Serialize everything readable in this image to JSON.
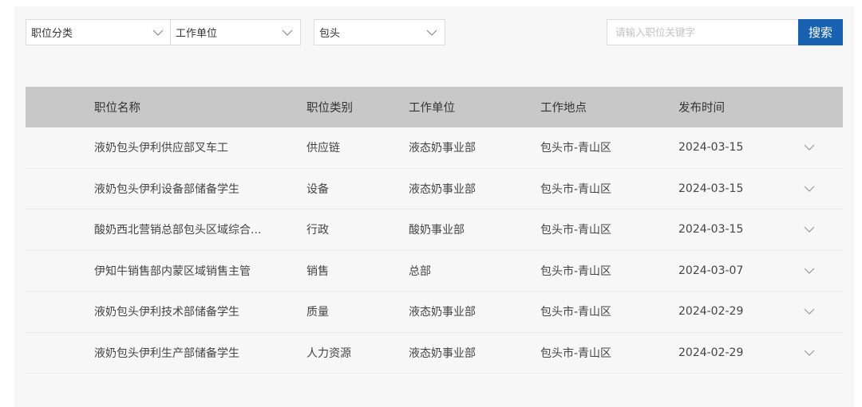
{
  "filters": {
    "category": {
      "value": "职位分类"
    },
    "unit": {
      "value": "工作单位"
    },
    "location": {
      "value": "包头"
    }
  },
  "search": {
    "placeholder": "请输入职位关键字",
    "value": "",
    "button_label": "搜索",
    "button_color": "#1860b0"
  },
  "table": {
    "headers": [
      "职位名称",
      "职位类别",
      "工作单位",
      "工作地点",
      "发布时间"
    ],
    "rows": [
      {
        "title": "液奶包头伊利供应部叉车工",
        "category": "供应链",
        "unit": "液态奶事业部",
        "location": "包头市-青山区",
        "date": "2024-03-15"
      },
      {
        "title": "液奶包头伊利设备部储备学生",
        "category": "设备",
        "unit": "液态奶事业部",
        "location": "包头市-青山区",
        "date": "2024-03-15"
      },
      {
        "title": "酸奶西北营销总部包头区域综合...",
        "category": "行政",
        "unit": "酸奶事业部",
        "location": "包头市-青山区",
        "date": "2024-03-15"
      },
      {
        "title": "伊知牛销售部内蒙区域销售主管",
        "category": "销售",
        "unit": "总部",
        "location": "包头市-青山区",
        "date": "2024-03-07"
      },
      {
        "title": "液奶包头伊利技术部储备学生",
        "category": "质量",
        "unit": "液态奶事业部",
        "location": "包头市-青山区",
        "date": "2024-02-29"
      },
      {
        "title": "液奶包头伊利生产部储备学生",
        "category": "人力资源",
        "unit": "液态奶事业部",
        "location": "包头市-青山区",
        "date": "2024-02-29"
      }
    ],
    "row_icon": "chevron-down-icon"
  },
  "colors": {
    "header_bg": "#c8c8c8",
    "panel_bg": "#f7f7f7"
  }
}
